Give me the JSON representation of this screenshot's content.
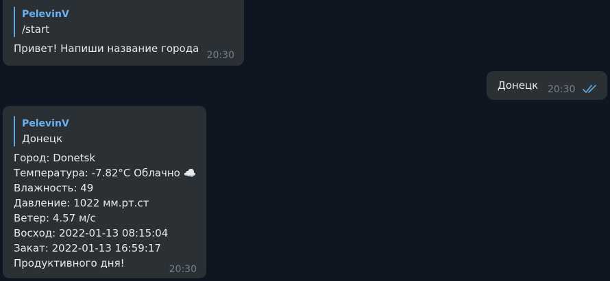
{
  "messages": [
    {
      "reply": {
        "author": "PelevinV",
        "text": "/start"
      },
      "body": "Привет! Напиши название города",
      "time": "20:30"
    },
    {
      "body": "Донецк",
      "time": "20:30",
      "status_icon": "double-check-icon"
    },
    {
      "reply": {
        "author": "PelevinV",
        "text": "Донецк"
      },
      "body": "Город: Donetsk\nТемпература: -7.82°C Облачно ☁️\nВлажность: 49\nДавление: 1022 мм.рт.ст\nВетер: 4.57 м/с\nВосход: 2022-01-13 08:15:04\nЗакат: 2022-01-13 16:59:17\nПродуктивного дня!",
      "time": "20:30"
    }
  ],
  "colors": {
    "background": "#0e1621",
    "bubble": "#2b3035",
    "reply_accent": "#6ab3f3",
    "check": "#5ea8e0"
  }
}
